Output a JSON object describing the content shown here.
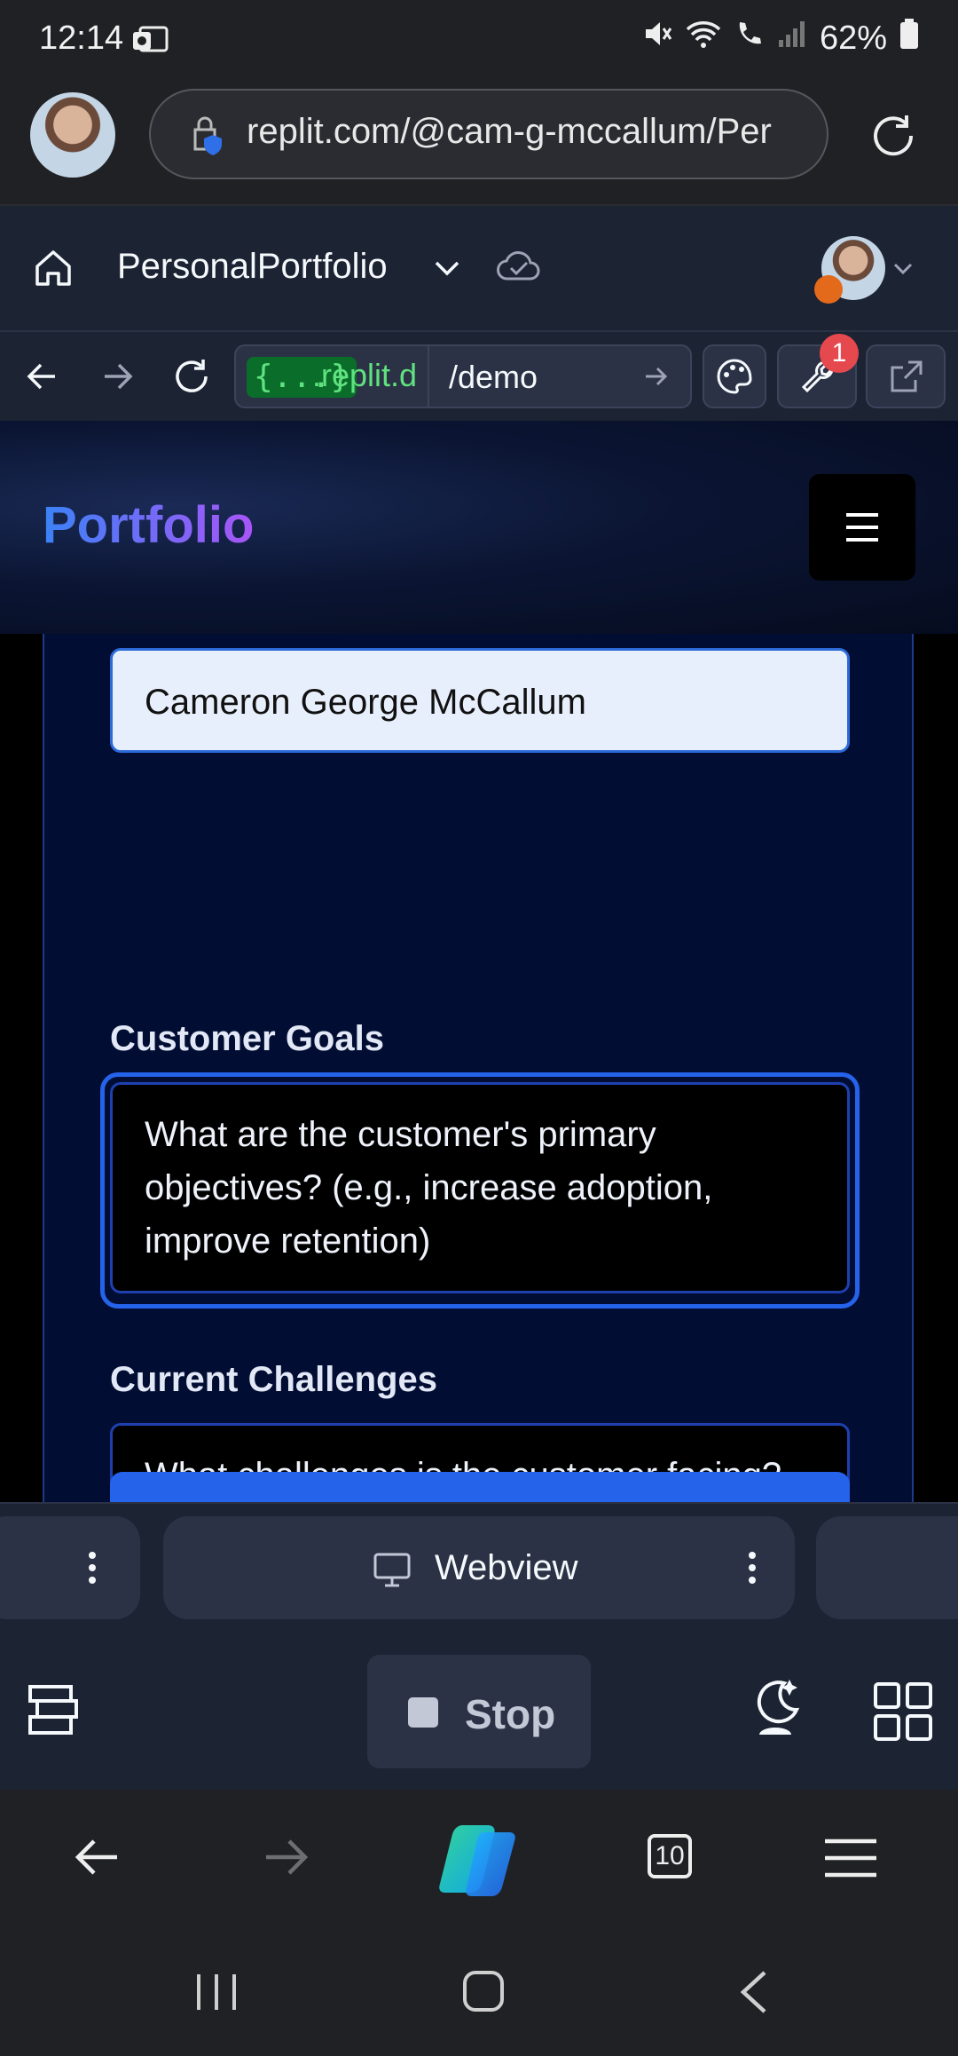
{
  "status_bar": {
    "time": "12:14",
    "battery": "62%"
  },
  "browser": {
    "url": "replit.com/@cam-g-mccallum/Per"
  },
  "replit": {
    "project_name": "PersonalPortfolio",
    "dev_tag": "{...}",
    "domain_suffix": ".replit.d",
    "path": "/demo",
    "devtools_badge": "1",
    "tab_label": "Webview",
    "stop_label": "Stop"
  },
  "site": {
    "logo": "Portfolio",
    "name_value": "Cameron George McCallum",
    "goals_label": "Customer Goals",
    "goals_placeholder": "What are the customer's primary objectives? (e.g., increase adoption, improve retention)",
    "challenges_label": "Current Challenges",
    "challenges_placeholder": "What challenges is the customer facing? (e.g., low engagement, onboarding issues)"
  },
  "browser_nav": {
    "tab_count": "10"
  },
  "colors": {
    "accent": "#2563eb",
    "replit_bg": "#1c2333",
    "card_bg": "#020d33"
  }
}
